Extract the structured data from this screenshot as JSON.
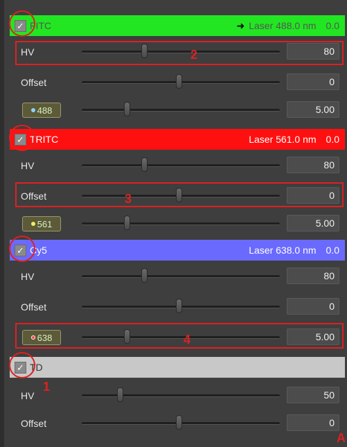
{
  "channels": {
    "fitc": {
      "name": "FITC",
      "laser": "Laser 488.0 nm",
      "power": "0.0",
      "color": "#22e622",
      "text_color": "#555555",
      "hv": {
        "label": "HV",
        "value": "80",
        "level": 0.31
      },
      "offset": {
        "label": "Offset",
        "value": "0",
        "level": 0.49
      },
      "laser_btn": {
        "label": "488",
        "dot_color": "#8fd0ff",
        "value": "5.00",
        "level": 0.22
      }
    },
    "tritc": {
      "name": "TRITC",
      "laser": "Laser 561.0 nm",
      "power": "0.0",
      "color": "#ff1010",
      "text_color": "#ffffff",
      "hv": {
        "label": "HV",
        "value": "80",
        "level": 0.31
      },
      "offset": {
        "label": "Offset",
        "value": "0",
        "level": 0.49
      },
      "laser_btn": {
        "label": "561",
        "dot_color": "#f0f060",
        "value": "5.00",
        "level": 0.22
      }
    },
    "cy5": {
      "name": "Cy5",
      "laser": "Laser 638.0 nm",
      "power": "0.0",
      "color": "#6a6aff",
      "text_color": "#ffffff",
      "hv": {
        "label": "HV",
        "value": "80",
        "level": 0.31
      },
      "offset": {
        "label": "Offset",
        "value": "0",
        "level": 0.49
      },
      "laser_btn": {
        "label": "638",
        "dot_color": "#ff6060",
        "value": "5.00",
        "level": 0.22
      }
    },
    "td": {
      "name": "TD",
      "color": "#c8c8c8",
      "text_color": "#333333",
      "hv": {
        "label": "HV",
        "value": "50",
        "level": 0.19
      },
      "offset": {
        "label": "Offset",
        "value": "0",
        "level": 0.49
      }
    }
  },
  "annotations": {
    "n1": "1",
    "n2": "2",
    "n3": "3",
    "n4": "4",
    "corner": "A"
  },
  "icons": {
    "checkbox": "checkmark-icon",
    "arrow": "arrow-right-icon",
    "dot": "circle-dot-icon"
  }
}
